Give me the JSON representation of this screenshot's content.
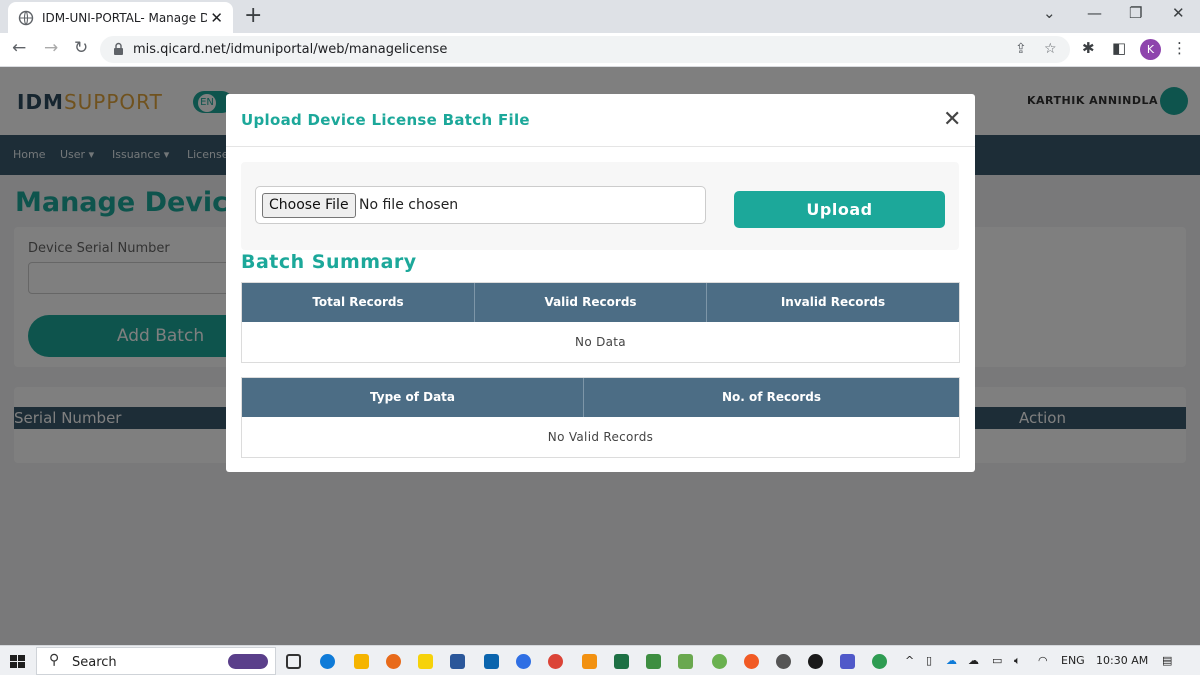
{
  "browser": {
    "tab_title": "IDM-UNI-PORTAL- Manage Devi",
    "url": "mis.qicard.net/idmuniportal/web/managelicense",
    "profile_initial": "K"
  },
  "site": {
    "logo_bold": "IDM",
    "logo_light": "SUPPORT",
    "lang": "EN",
    "user_name": "KARTHIK ANNINDLA",
    "nav": [
      "Home",
      "User",
      "Issuance",
      "License"
    ],
    "page_title": "Manage Device",
    "filter_label": "Device Serial Number",
    "add_batch": "Add Batch",
    "col_serial": "Serial Number",
    "col_action": "Action"
  },
  "modal": {
    "title": "Upload Device License Batch File",
    "choose_file": "Choose File",
    "no_file": "No file chosen",
    "upload": "Upload",
    "batch_summary": "Batch Summary",
    "summary_headers": [
      "Total Records",
      "Valid Records",
      "Invalid Records"
    ],
    "summary_empty": "No Data",
    "detail_headers": [
      "Type of Data",
      "No. of Records"
    ],
    "detail_empty": "No Valid Records"
  },
  "taskbar": {
    "search": "Search",
    "lang": "ENG",
    "time": "10:30 AM"
  },
  "colors": {
    "accent": "#1ca89a",
    "header_blue": "#4c6d85",
    "logo_gold": "#e0a43d"
  }
}
